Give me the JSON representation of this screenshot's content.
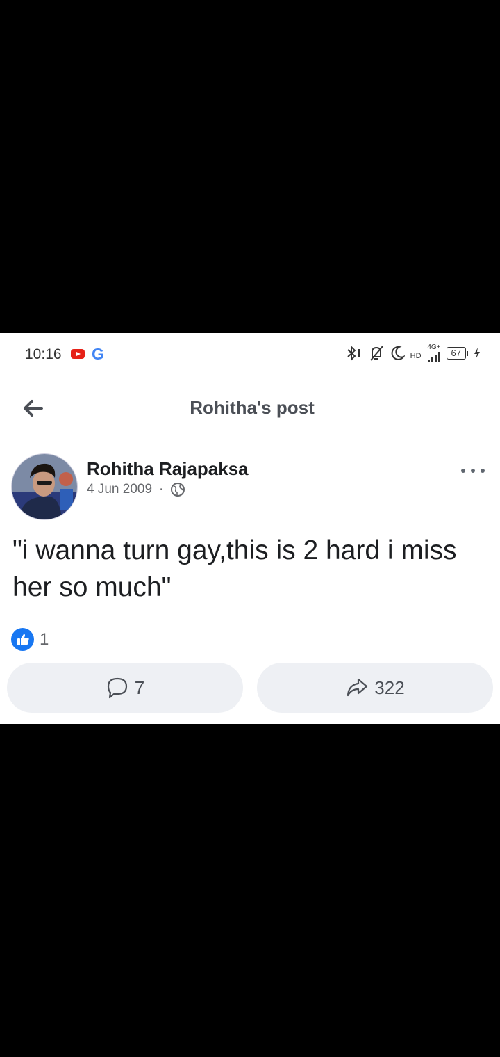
{
  "status_bar": {
    "time": "10:16",
    "network": "4G+",
    "hd": "HD",
    "battery": "67",
    "icons": [
      "youtube-icon",
      "google-icon",
      "bluetooth-icon",
      "mute-icon",
      "moon-icon",
      "signal-icon",
      "battery-icon",
      "charging-icon"
    ]
  },
  "header": {
    "title": "Rohitha's post",
    "back_icon": "arrow-left-icon"
  },
  "post": {
    "author": "Rohitha Rajapaksa",
    "date": "4 Jun 2009",
    "separator": "·",
    "privacy_icon": "globe-icon",
    "more_icon": "more-horizontal-icon",
    "text": "\"i wanna turn gay,this is 2 hard i miss her so much\"",
    "reactions": {
      "like_count": "1",
      "icon": "like-icon"
    },
    "comment_count": "7",
    "share_count": "322"
  },
  "colors": {
    "like_blue": "#1877f2",
    "button_bg": "#eef0f4",
    "text_primary": "#1c1e21",
    "text_secondary": "#65676b"
  }
}
